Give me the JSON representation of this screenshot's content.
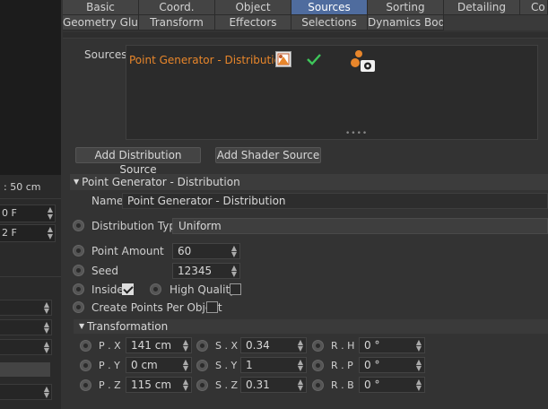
{
  "tabs_row1": [
    "Basic",
    "Coord.",
    "Object",
    "Sources",
    "Sorting",
    "Detailing",
    "Co"
  ],
  "tabs_row2": [
    "Geometry Glue",
    "Transform",
    "Effectors",
    "Selections",
    "Dynamics Body"
  ],
  "active_tab": "Sources",
  "left": {
    "readout": ": 50 cm",
    "frame_a": "0 F",
    "frame_b": "2 F"
  },
  "sources": {
    "label": "Sources",
    "item_name": "Point Generator - Distribution",
    "accent": "#e8862b"
  },
  "buttons": {
    "add_distribution": "Add Distribution Source",
    "add_shader": "Add Shader Source"
  },
  "section": {
    "title": "Point Generator - Distribution",
    "name_label": "Name",
    "name_value": "Point Generator - Distribution",
    "distribution_type_label": "Distribution Type",
    "distribution_type_value": "Uniform",
    "point_amount_label": "Point Amount",
    "point_amount_value": "60",
    "seed_label": "Seed",
    "seed_value": "12345",
    "inside_label": "Inside",
    "inside_checked": true,
    "high_quality_label": "High Quality",
    "high_quality_checked": false,
    "create_points_label": "Create Points Per Object",
    "create_points_checked": false
  },
  "transformation": {
    "title": "Transformation",
    "px_label": "P . X",
    "px_value": "141 cm",
    "py_label": "P . Y",
    "py_value": "0 cm",
    "pz_label": "P . Z",
    "pz_value": "115 cm",
    "sx_label": "S . X",
    "sx_value": "0.34",
    "sy_label": "S . Y",
    "sy_value": "1",
    "sz_label": "S . Z",
    "sz_value": "0.31",
    "rh_label": "R . H",
    "rh_value": "0 °",
    "rp_label": "R . P",
    "rp_value": "0 °",
    "rb_label": "R . B",
    "rb_value": "0 °"
  }
}
